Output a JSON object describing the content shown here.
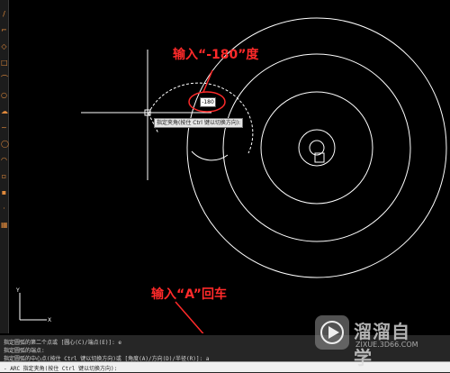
{
  "canvas": {
    "dynamic_input_value": "-180",
    "tooltip_text": "指定夹角(按住 Ctrl 键以切换方向):"
  },
  "annotations": {
    "top_note": "输入“-180”度",
    "bottom_note": "输入“A”回车"
  },
  "command_history": [
    "指定圆弧的第二个点或 [圆心(C)/端点(E)]: e",
    "指定圆弧的端点:",
    "指定圆弧的中心点(按住 Ctrl 键以切换方向)或 [角度(A)/方向(D)/半径(R)]: a"
  ],
  "command_input": "- ARC 指定夹角(按住 Ctrl 键以切换方向):",
  "watermark": {
    "title": "溜溜自学",
    "subtitle": "ZIXUE.3D66.COM"
  },
  "colors": {
    "annotation": "#ff2a2a",
    "drawing": "#ffffff",
    "background": "#000000",
    "toolbar_icons": "#e08a3c"
  }
}
